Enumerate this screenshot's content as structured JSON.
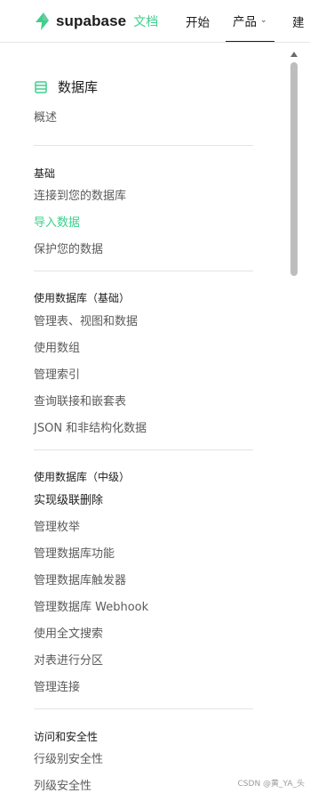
{
  "header": {
    "brand": "supabase",
    "docs_label": "文档",
    "nav": {
      "start": "开始",
      "product": "产品",
      "build": "建"
    }
  },
  "sidebar": {
    "section_title": "数据库",
    "overview": "概述",
    "groups": [
      {
        "title": "基础",
        "items": [
          "连接到您的数据库",
          "导入数据",
          "保护您的数据"
        ]
      },
      {
        "title": "使用数据库（基础）",
        "items": [
          "管理表、视图和数据",
          "使用数组",
          "管理索引",
          "查询联接和嵌套表",
          "JSON 和非结构化数据"
        ]
      },
      {
        "title": "使用数据库（中级）",
        "items": [
          "实现级联删除",
          "管理枚举",
          "管理数据库功能",
          "管理数据库触发器",
          "管理数据库 Webhook",
          "使用全文搜索",
          "对表进行分区",
          "管理连接"
        ]
      },
      {
        "title": "访问和安全性",
        "items": [
          "行级别安全性",
          "列级安全性"
        ]
      }
    ],
    "active_item": "导入数据"
  },
  "watermark": "CSDN @黄_YA_头",
  "colors": {
    "accent": "#3ecf8e",
    "text_primary": "#1c1c1c",
    "text_secondary": "#5b5b5b",
    "divider": "#e3e3e3"
  },
  "icons": {
    "brand": "supabase-bolt-icon",
    "section": "database-list-icon",
    "dropdown": "chevron-down-icon"
  }
}
